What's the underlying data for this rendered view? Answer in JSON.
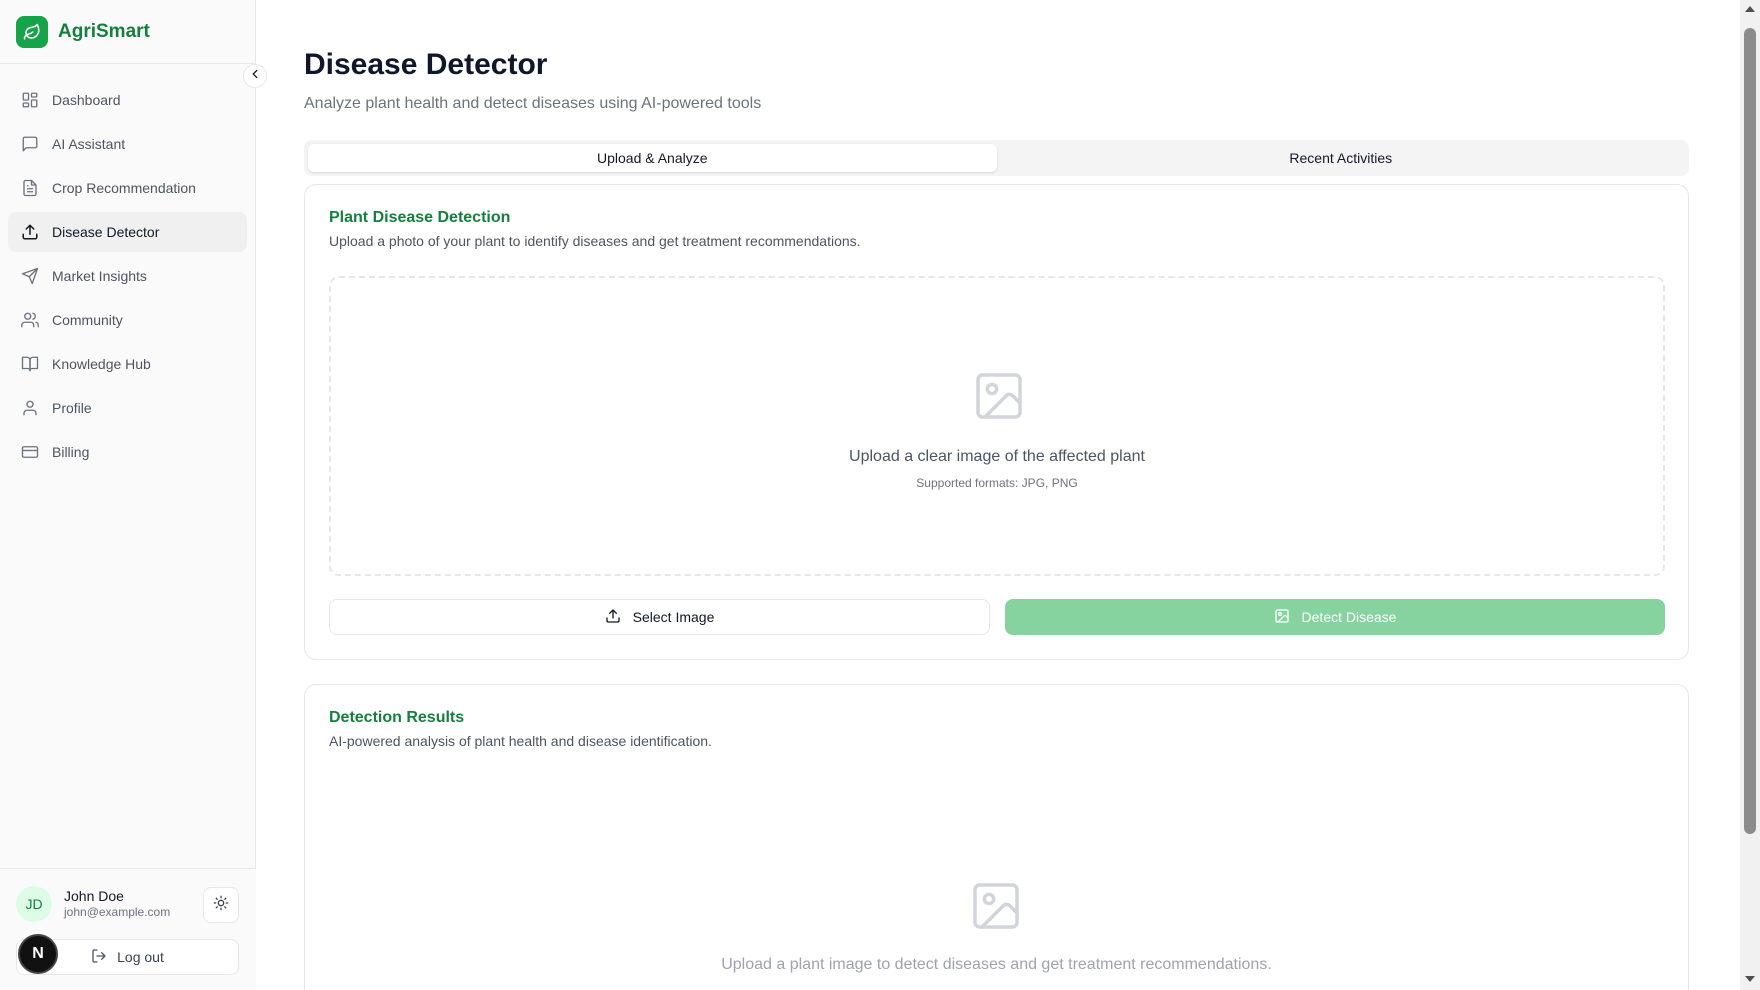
{
  "app": {
    "name": "AgriSmart"
  },
  "sidebar": {
    "items": [
      {
        "label": "Dashboard",
        "icon": "dashboard-icon"
      },
      {
        "label": "AI Assistant",
        "icon": "message-square-icon"
      },
      {
        "label": "Crop Recommendation",
        "icon": "file-text-icon"
      },
      {
        "label": "Disease Detector",
        "icon": "upload-icon",
        "active": true
      },
      {
        "label": "Market Insights",
        "icon": "send-icon"
      },
      {
        "label": "Community",
        "icon": "users-icon"
      },
      {
        "label": "Knowledge Hub",
        "icon": "book-open-icon"
      },
      {
        "label": "Profile",
        "icon": "user-icon"
      },
      {
        "label": "Billing",
        "icon": "credit-card-icon"
      }
    ]
  },
  "user": {
    "initials": "JD",
    "name": "John Doe",
    "email": "john@example.com",
    "logout_label": "Log out"
  },
  "next_badge": "N",
  "page": {
    "title": "Disease Detector",
    "subtitle": "Analyze plant health and detect diseases using AI-powered tools"
  },
  "tabs": [
    {
      "label": "Upload & Analyze",
      "active": true
    },
    {
      "label": "Recent Activities",
      "active": false
    }
  ],
  "upload_card": {
    "title": "Plant Disease Detection",
    "description": "Upload a photo of your plant to identify diseases and get treatment recommendations.",
    "dropzone_text": "Upload a clear image of the affected plant",
    "dropzone_sub": "Supported formats: JPG, PNG",
    "select_label": "Select Image",
    "detect_label": "Detect Disease"
  },
  "results_card": {
    "title": "Detection Results",
    "description": "AI-powered analysis of plant health and disease identification.",
    "empty_text": "Upload a plant image to detect diseases and get treatment recommendations."
  },
  "colors": {
    "brand": "#16a34a",
    "brand_text": "#15803d",
    "detect_button_disabled": "#86d3a0"
  }
}
